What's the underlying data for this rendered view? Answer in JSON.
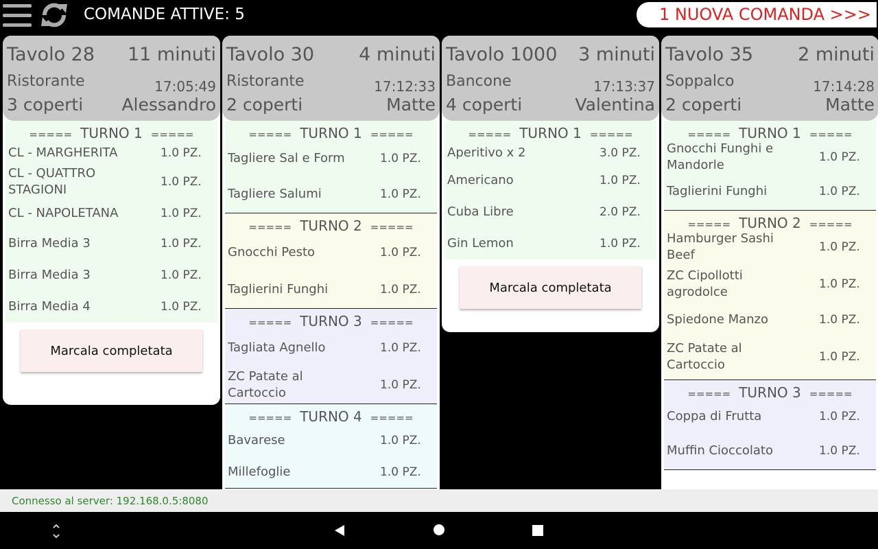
{
  "header": {
    "menu_icon": "hamburger-menu-icon",
    "refresh_icon": "refresh-icon",
    "title": "COMANDE ATTIVE: 5",
    "new_order": "1 NUOVA COMANDA >>>"
  },
  "orders": [
    {
      "table": "Tavolo 28",
      "elapsed": "11 minuti",
      "area": "Ristorante",
      "time": "17:05:49",
      "covers": "3 coperti",
      "waiter": "Alessandro",
      "turns": [
        {
          "title": "TURNO 1",
          "items": [
            {
              "name": "CL - MARGHERITA",
              "qty": "1.0 PZ."
            },
            {
              "name": "CL - QUATTRO STAGIONI",
              "qty": "1.0 PZ."
            },
            {
              "name": "CL - NAPOLETANA",
              "qty": "1.0 PZ."
            },
            {
              "name": "Birra Media 3",
              "qty": "1.0 PZ."
            },
            {
              "name": "Birra Media 3",
              "qty": "1.0 PZ."
            },
            {
              "name": "Birra Media 4",
              "qty": "1.0 PZ."
            }
          ]
        }
      ],
      "complete_label": "Marcala completata"
    },
    {
      "table": "Tavolo 30",
      "elapsed": "4 minuti",
      "area": "Ristorante",
      "time": "17:12:33",
      "covers": "2 coperti",
      "waiter": "Matte",
      "turns": [
        {
          "title": "TURNO 1",
          "items": [
            {
              "name": "Tagliere Sal e Form",
              "qty": "1.0 PZ."
            },
            {
              "name": "Tagliere Salumi",
              "qty": "1.0 PZ."
            }
          ]
        },
        {
          "title": "TURNO 2",
          "items": [
            {
              "name": "Gnocchi Pesto",
              "qty": "1.0 PZ."
            },
            {
              "name": "Taglierini Funghi",
              "qty": "1.0 PZ."
            }
          ]
        },
        {
          "title": "TURNO 3",
          "items": [
            {
              "name": "Tagliata Agnello",
              "qty": "1.0 PZ."
            },
            {
              "name": "ZC Patate al Cartoccio",
              "qty": "1.0 PZ."
            }
          ]
        },
        {
          "title": "TURNO 4",
          "items": [
            {
              "name": "Bavarese",
              "qty": "1.0 PZ."
            },
            {
              "name": "Millefoglie",
              "qty": "1.0 PZ."
            }
          ]
        }
      ]
    },
    {
      "table": "Tavolo 1000",
      "elapsed": "3 minuti",
      "area": "Bancone",
      "time": "17:13:37",
      "covers": "4 coperti",
      "waiter": "Valentina",
      "turns": [
        {
          "title": "TURNO 1",
          "items": [
            {
              "name": "Aperitivo x 2",
              "qty": "3.0 PZ."
            },
            {
              "name": "Americano",
              "qty": "1.0 PZ."
            },
            {
              "name": "Cuba Libre",
              "qty": "2.0 PZ."
            },
            {
              "name": "Gin Lemon",
              "qty": "1.0 PZ."
            }
          ]
        }
      ],
      "complete_label": "Marcala completata"
    },
    {
      "table": "Tavolo 35",
      "elapsed": "2 minuti",
      "area": "Soppalco",
      "time": "17:14:28",
      "covers": "2 coperti",
      "waiter": "Matte",
      "turns": [
        {
          "title": "TURNO 1",
          "items": [
            {
              "name": "Gnocchi Funghi e Mandorle",
              "qty": "1.0 PZ."
            },
            {
              "name": "Taglierini Funghi",
              "qty": "1.0 PZ."
            }
          ]
        },
        {
          "title": "TURNO 2",
          "items": [
            {
              "name": "Hamburger Sashi Beef",
              "qty": "1.0 PZ."
            },
            {
              "name": "ZC Cipollotti agrodolce",
              "qty": "1.0 PZ."
            },
            {
              "name": "Spiedone Manzo",
              "qty": "1.0 PZ."
            },
            {
              "name": "ZC Patate al Cartoccio",
              "qty": "1.0 PZ."
            }
          ]
        },
        {
          "title": "TURNO 3",
          "items": [
            {
              "name": "Coppa di Frutta",
              "qty": "1.0 PZ."
            },
            {
              "name": "Muffin Cioccolato",
              "qty": "1.0 PZ."
            }
          ]
        }
      ]
    }
  ],
  "turn_marker": "=====",
  "status": {
    "text": "Connesso al server: 192.168.0.5:8080"
  },
  "nav": {
    "updown_icon": "rotate-updown-icon",
    "back_icon": "back-triangle-icon",
    "home_icon": "home-circle-icon",
    "recent_icon": "recent-square-icon"
  }
}
